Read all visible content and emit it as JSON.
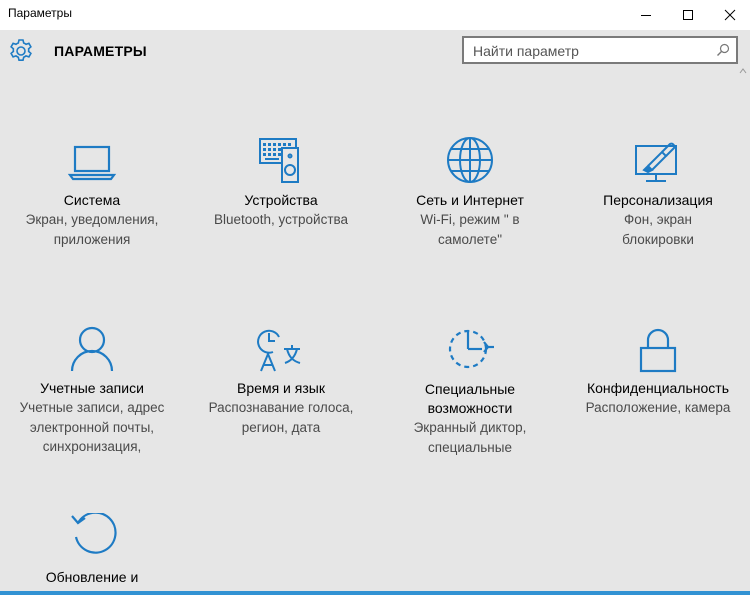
{
  "window": {
    "title": "Параметры"
  },
  "header": {
    "title": "ПАРАМЕТРЫ",
    "search_placeholder": "Найти параметр"
  },
  "accent_color": "#1e7bc4",
  "tiles": [
    {
      "icon": "laptop-icon",
      "label": "Система",
      "desc_lines": [
        "Экран, уведомления,",
        "приложения"
      ]
    },
    {
      "icon": "devices-icon",
      "label": "Устройства",
      "desc_lines": [
        "Bluetooth, устройства",
        ""
      ]
    },
    {
      "icon": "globe-icon",
      "label": "Сеть и Интернет",
      "desc_lines": [
        "Wi-Fi, режим \" в",
        "самолете\""
      ]
    },
    {
      "icon": "personalization-icon",
      "label": "Персонализация",
      "desc_lines": [
        "Фон, экран",
        "блокировки"
      ]
    },
    {
      "icon": "person-icon",
      "label": "Учетные записи",
      "desc_lines": [
        "Учетные записи, адрес",
        "электронной почты,",
        "синхронизация,"
      ]
    },
    {
      "icon": "time-language-icon",
      "label": "Время и язык",
      "desc_lines": [
        "Распознавание голоса,",
        "регион, дата",
        ""
      ]
    },
    {
      "icon": "ease-of-access-icon",
      "label_lines": [
        "Специальные",
        "возможности"
      ],
      "desc_lines": [
        "Экранный диктор,",
        "специальные"
      ]
    },
    {
      "icon": "lock-icon",
      "label": "Конфиденциальность",
      "desc_lines": [
        "Расположение, камера"
      ]
    },
    {
      "icon": "update-icon",
      "label": "Обновление и",
      "desc_lines": []
    }
  ]
}
